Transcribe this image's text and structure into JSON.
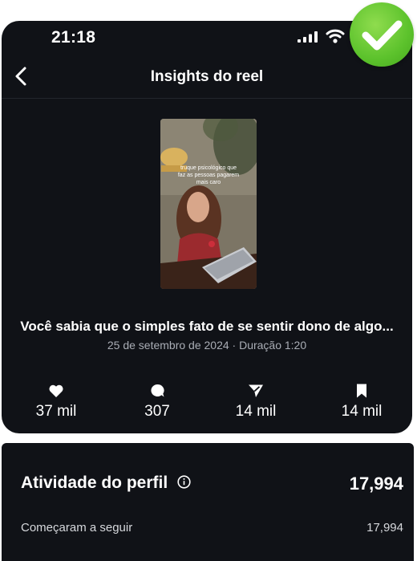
{
  "status_bar": {
    "time": "21:18"
  },
  "header": {
    "title": "Insights do reel"
  },
  "reel": {
    "thumbnail_text": [
      "truque psicológico que",
      "faz as pessoas pagarem",
      "mais caro"
    ],
    "caption": "Você sabia que o simples fato de se sentir dono de algo...",
    "meta": "25 de setembro de 2024 · Duração 1:20"
  },
  "stats": [
    {
      "icon": "heart-icon",
      "value": "37 mil"
    },
    {
      "icon": "comment-icon",
      "value": "307"
    },
    {
      "icon": "share-icon",
      "value": "14 mil"
    },
    {
      "icon": "bookmark-icon",
      "value": "14 mil"
    }
  ],
  "profile_activity": {
    "title": "Atividade do perfil",
    "total": "17,994",
    "rows": [
      {
        "label": "Começaram a seguir",
        "value": "17,994"
      }
    ]
  },
  "colors": {
    "background": "#101217",
    "badge": "#5cc22c"
  }
}
